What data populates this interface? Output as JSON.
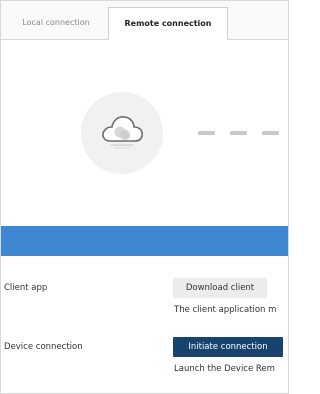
{
  "tabs": {
    "local": "Local connection",
    "remote": "Remote connection"
  },
  "client_app": {
    "label": "Client app",
    "button": "Download client",
    "description": "The client application m"
  },
  "device_connection": {
    "label": "Device connection",
    "button": "Initiate connection",
    "description": "Launch the Device Rem"
  },
  "colors": {
    "accent_band": "#3f87d0",
    "primary_button": "#17446f",
    "secondary_button": "#ececec"
  },
  "icons": [
    "cloud-icon",
    "dashed-connector"
  ]
}
